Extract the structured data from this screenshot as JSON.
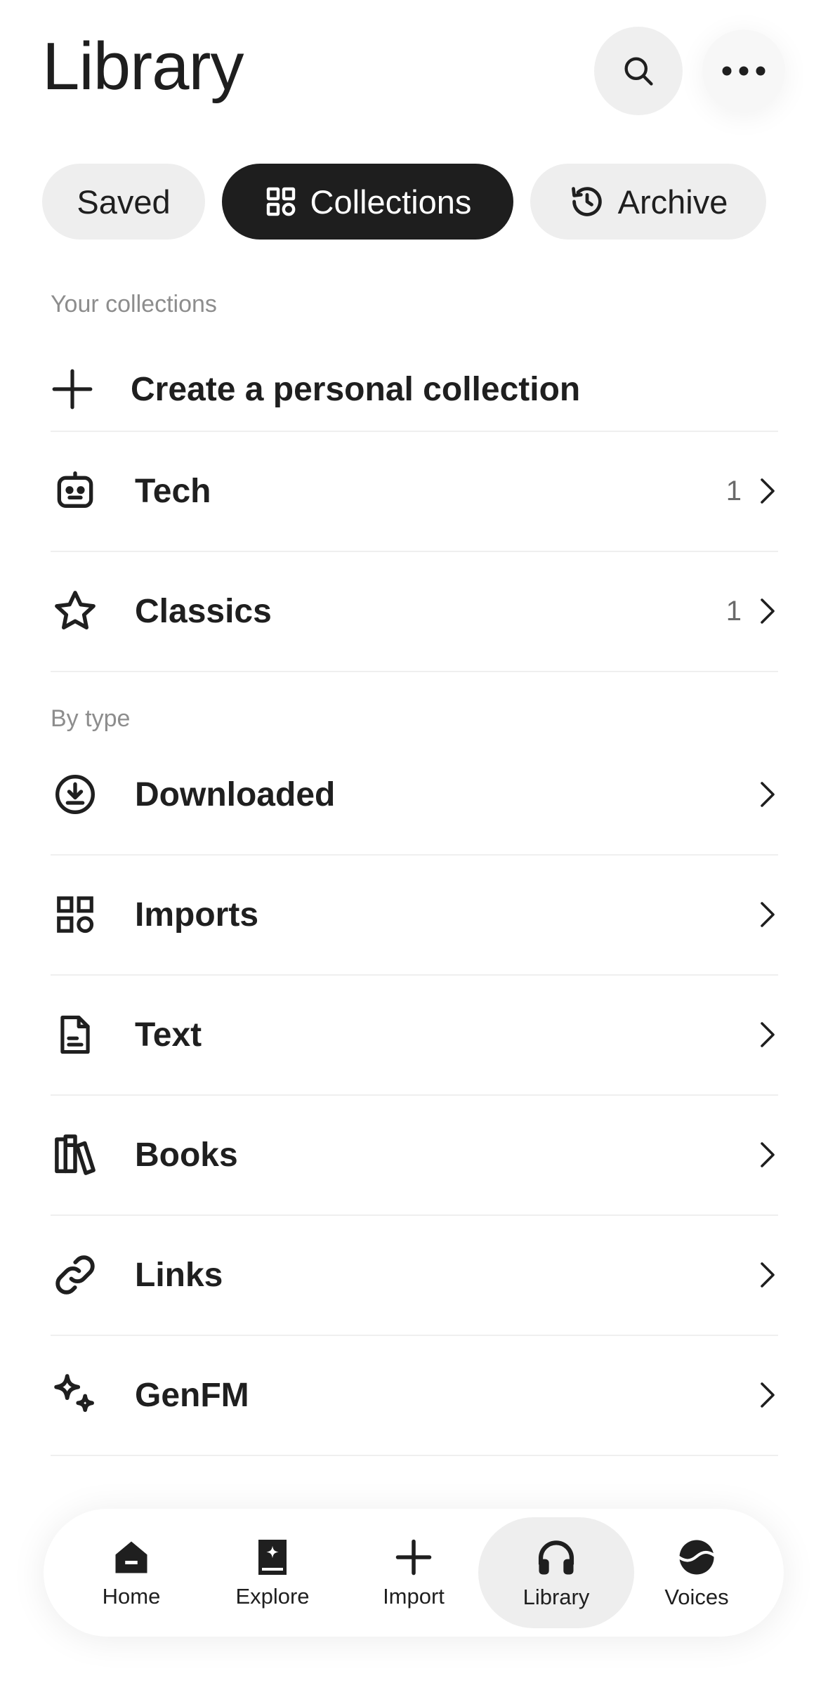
{
  "header": {
    "title": "Library",
    "search_icon": "search-icon",
    "more_icon": "more-horizontal-icon"
  },
  "tabs": [
    {
      "label": "Saved",
      "active": false
    },
    {
      "label": "Collections",
      "active": true,
      "icon": "grid-icon"
    },
    {
      "label": "Archive",
      "active": false,
      "icon": "history-icon"
    }
  ],
  "collections": {
    "section_label": "Your collections",
    "create_label": "Create a personal collection",
    "items": [
      {
        "label": "Tech",
        "count": "1",
        "icon": "robot-icon"
      },
      {
        "label": "Classics",
        "count": "1",
        "icon": "star-icon"
      }
    ]
  },
  "by_type": {
    "section_label": "By type",
    "items": [
      {
        "label": "Downloaded",
        "icon": "download-icon"
      },
      {
        "label": "Imports",
        "icon": "imports-grid-icon"
      },
      {
        "label": "Text",
        "icon": "document-icon"
      },
      {
        "label": "Books",
        "icon": "books-icon"
      },
      {
        "label": "Links",
        "icon": "link-icon"
      },
      {
        "label": "GenFM",
        "icon": "sparkles-icon"
      }
    ]
  },
  "bottom_nav": [
    {
      "label": "Home",
      "icon": "home-icon",
      "active": false
    },
    {
      "label": "Explore",
      "icon": "explore-icon",
      "active": false
    },
    {
      "label": "Import",
      "icon": "plus-icon",
      "active": false
    },
    {
      "label": "Library",
      "icon": "headphones-icon",
      "active": true
    },
    {
      "label": "Voices",
      "icon": "voices-icon",
      "active": false
    }
  ],
  "colors": {
    "accent_dark": "#1e1e1e",
    "pill_bg": "#eeeeee",
    "muted_text": "#8d8d8d"
  }
}
